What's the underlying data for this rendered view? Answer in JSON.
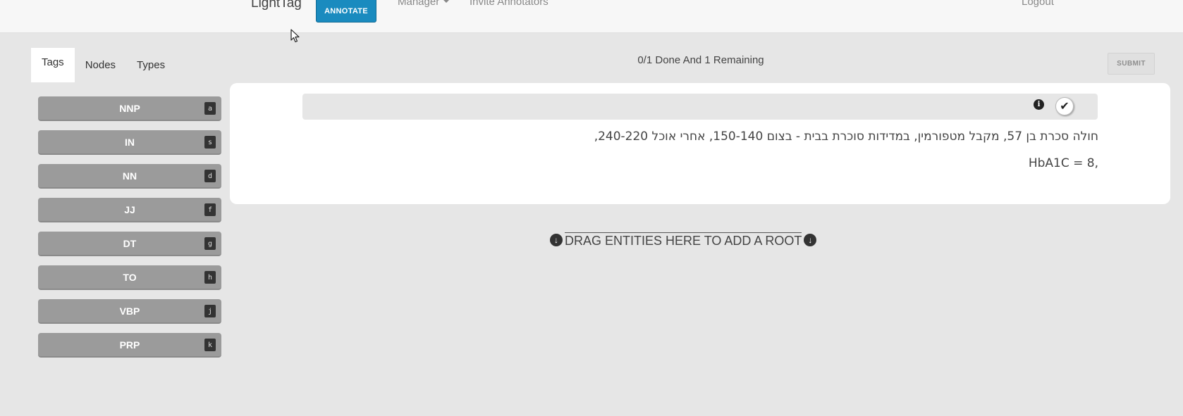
{
  "navbar": {
    "brand": "LightTag",
    "annotate_label": "ANNOTATE",
    "manager_label": "Manager",
    "invite_label": "Invite Annotators",
    "logout_label": "Logout"
  },
  "tabs": [
    {
      "label": "Tags",
      "active": true
    },
    {
      "label": "Nodes",
      "active": false
    },
    {
      "label": "Types",
      "active": false
    }
  ],
  "tags": [
    {
      "label": "NNP",
      "key": "a"
    },
    {
      "label": "IN",
      "key": "s"
    },
    {
      "label": "NN",
      "key": "d"
    },
    {
      "label": "JJ",
      "key": "f"
    },
    {
      "label": "DT",
      "key": "g"
    },
    {
      "label": "TO",
      "key": "h"
    },
    {
      "label": "VBP",
      "key": "j"
    },
    {
      "label": "PRP",
      "key": "k"
    }
  ],
  "progress": "0/1 Done And 1 Remaining",
  "submit_label": "SUBMIT",
  "document": {
    "line1": "חולה סכרת בן 57, מקבל מטפורמין, במדידות סוכרת בבית - בצום 150-140, אחרי אוכל 240-220,",
    "line2": "HbA1C = 8,"
  },
  "drop_zone_label": "DRAG ENTITIES HERE TO ADD A ROOT",
  "icons": {
    "info": "info-icon",
    "check": "check-icon",
    "arrow": "arrow-down-circle-icon",
    "cursor": "mouse-cursor-icon"
  },
  "colors": {
    "accent": "#1a8bbf",
    "tag_bg": "#9b9b9b",
    "page_bg": "#e6e6e6"
  }
}
